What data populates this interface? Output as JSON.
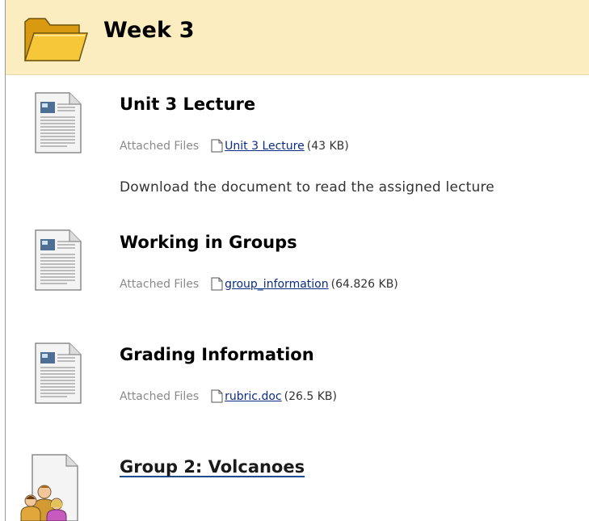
{
  "section": {
    "title": "Week 3",
    "icon": "folder-icon",
    "colors": {
      "header_bg": "#fcedc1",
      "link": "#0b2b86"
    }
  },
  "items": [
    {
      "title": "Unit 3 Lecture",
      "icon": "document-icon",
      "attachment_label": "Attached Files",
      "file_name": "Unit 3 Lecture",
      "file_size": "(43 KB)",
      "description": "Download the document to read the assigned lecture"
    },
    {
      "title": "Working in Groups",
      "icon": "document-icon",
      "attachment_label": "Attached Files",
      "file_name": "group_information",
      "file_size": "(64.826 KB)"
    },
    {
      "title": "Grading Information",
      "icon": "document-icon",
      "attachment_label": "Attached Files",
      "file_name": "rubric.doc",
      "file_size": "(26.5 KB)"
    },
    {
      "title": "Group 2: Volcanoes",
      "icon": "group-icon"
    }
  ]
}
